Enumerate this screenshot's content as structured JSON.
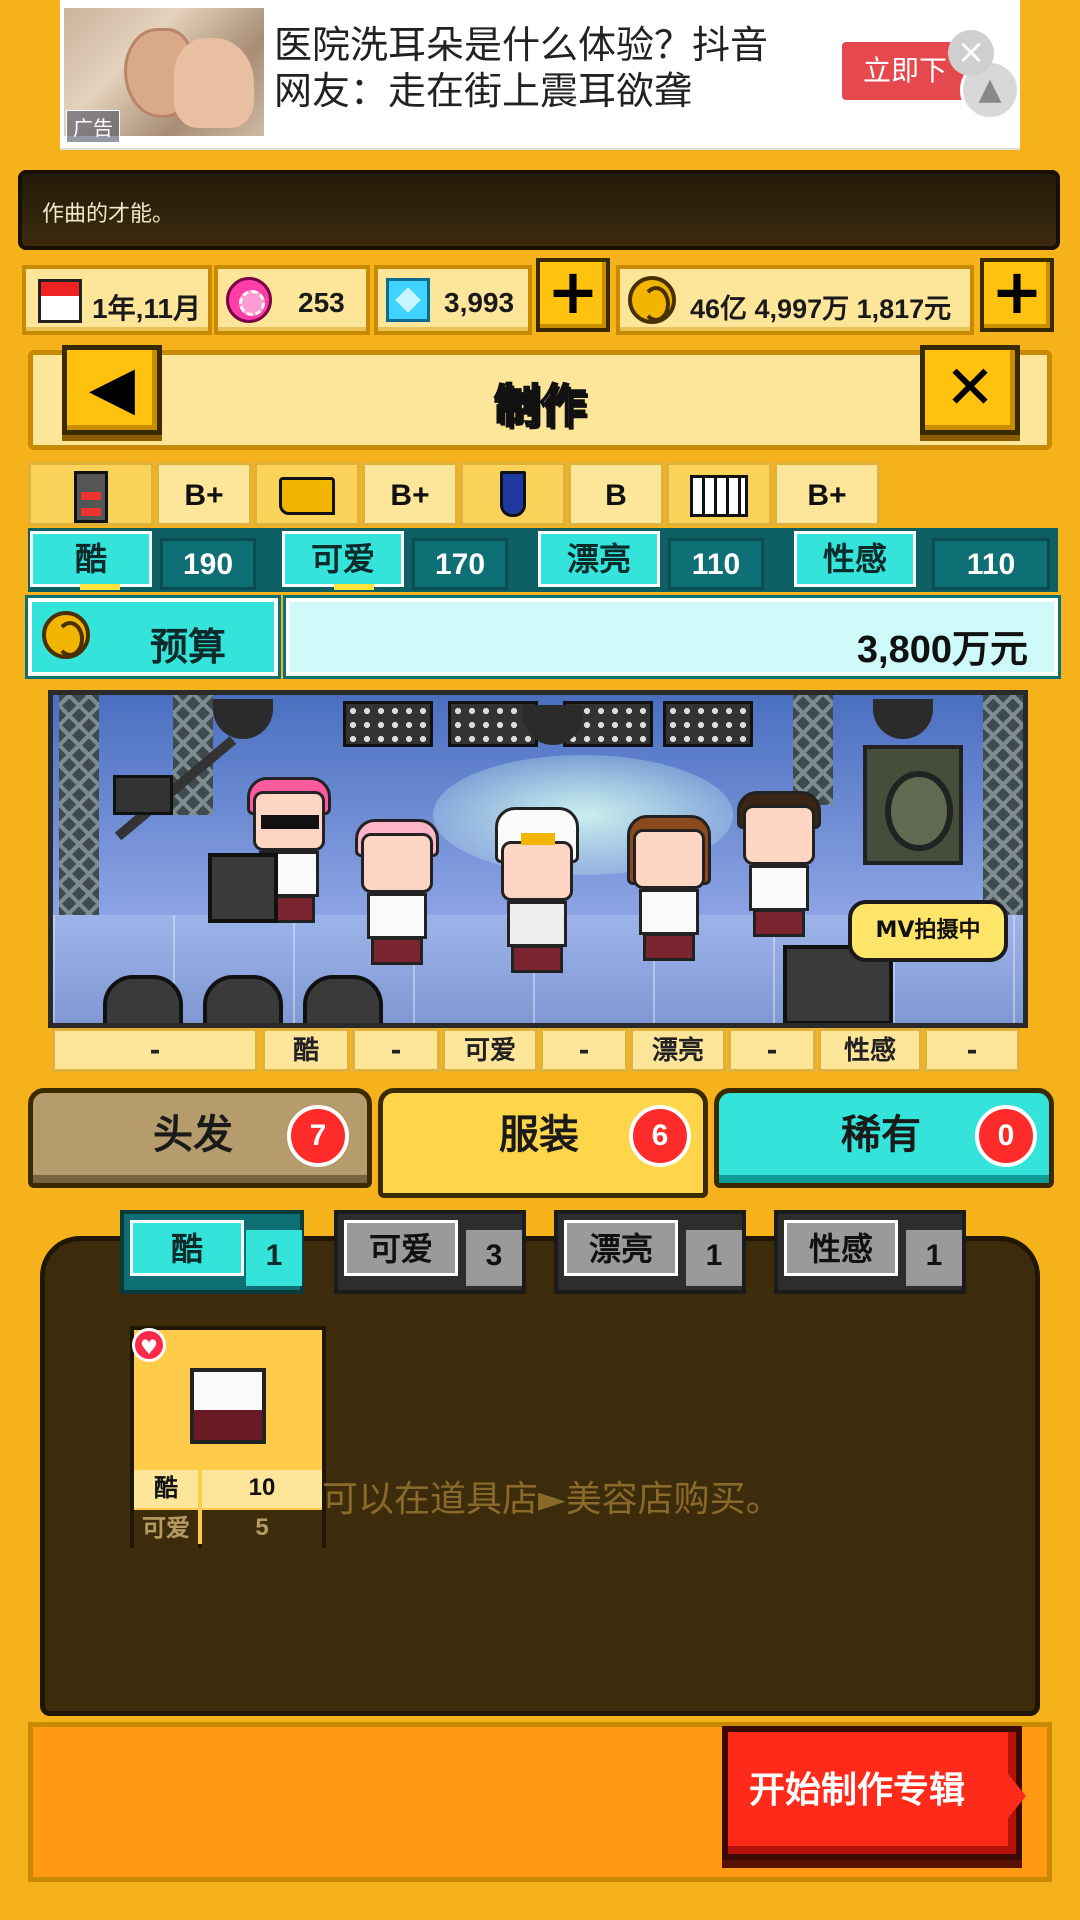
{
  "ad": {
    "headline": "医院洗耳朵是什么体验？抖音网友：走在街上震耳欲聋",
    "tag": "广告",
    "cta": "立即下",
    "close": "×"
  },
  "message": "作曲的才能。",
  "stats": {
    "date": "1年,11月",
    "gems": "253",
    "diamonds": "3,993",
    "money": "46亿 4,997万 1,817元",
    "plus": "+"
  },
  "header": {
    "title": "制作",
    "back_icon": "◀",
    "close_icon": "✕"
  },
  "grades": [
    "B+",
    "B+",
    "B",
    "B+"
  ],
  "attributes": [
    {
      "label": "酷",
      "value": "190"
    },
    {
      "label": "可爱",
      "value": "170"
    },
    {
      "label": "漂亮",
      "value": "110"
    },
    {
      "label": "性感",
      "value": "110"
    }
  ],
  "budget": {
    "label": "预算",
    "value": "3,800万元"
  },
  "scene": {
    "status_bubble": "MV拍摄中"
  },
  "progress_cells": [
    "-",
    "酷",
    "-",
    "可爱",
    "-",
    "漂亮",
    "-",
    "性感",
    "-"
  ],
  "category_tabs": [
    {
      "label": "头发",
      "count": "7"
    },
    {
      "label": "服装",
      "count": "6"
    },
    {
      "label": "稀有",
      "count": "0"
    }
  ],
  "sub_tabs": [
    {
      "label": "酷",
      "count": "1"
    },
    {
      "label": "可爱",
      "count": "3"
    },
    {
      "label": "漂亮",
      "count": "1"
    },
    {
      "label": "性感",
      "count": "1"
    }
  ],
  "item": {
    "stats": [
      {
        "label": "酷",
        "value": "10"
      },
      {
        "label": "可爱",
        "value": "5"
      }
    ]
  },
  "hint": "可以在道具店►美容店购买。",
  "start_button": "开始制作专辑",
  "colors": {
    "background": "#f5b21a",
    "accent_teal": "#34e3d9",
    "accent_red": "#ff2a1a"
  }
}
